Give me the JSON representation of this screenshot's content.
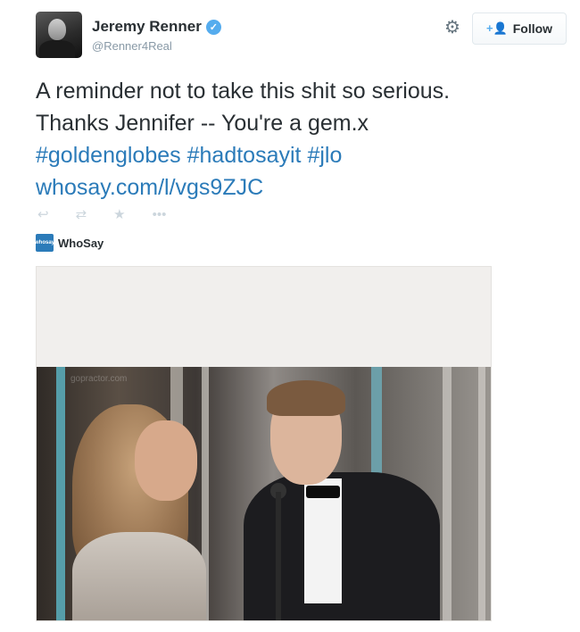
{
  "author": {
    "name": "Jeremy Renner",
    "handle": "@Renner4Real",
    "verified_glyph": "✓"
  },
  "header": {
    "follow_label": "Follow",
    "follow_icon": "+👤",
    "gear_icon": "⚙"
  },
  "tweet": {
    "line1": "A reminder not to take this shit so serious.",
    "line2": "Thanks Jennifer -- You're a gem.x",
    "hashtags": [
      "#goldenglobes",
      "#hadtosayit",
      "#jlo"
    ],
    "link": "whosay.com/l/vgs9ZJC"
  },
  "actions": {
    "reply_icon": "↩",
    "retweet_icon": "⇄",
    "favorite_icon": "★",
    "more_icon": "•••"
  },
  "card": {
    "source_logo_text": "whosay",
    "source_name": "WhoSay",
    "watermark": "gopractor.com"
  },
  "colors": {
    "link": "#2b7bb9",
    "verified": "#55acee",
    "text": "#292f33",
    "muted": "#8899a6"
  }
}
